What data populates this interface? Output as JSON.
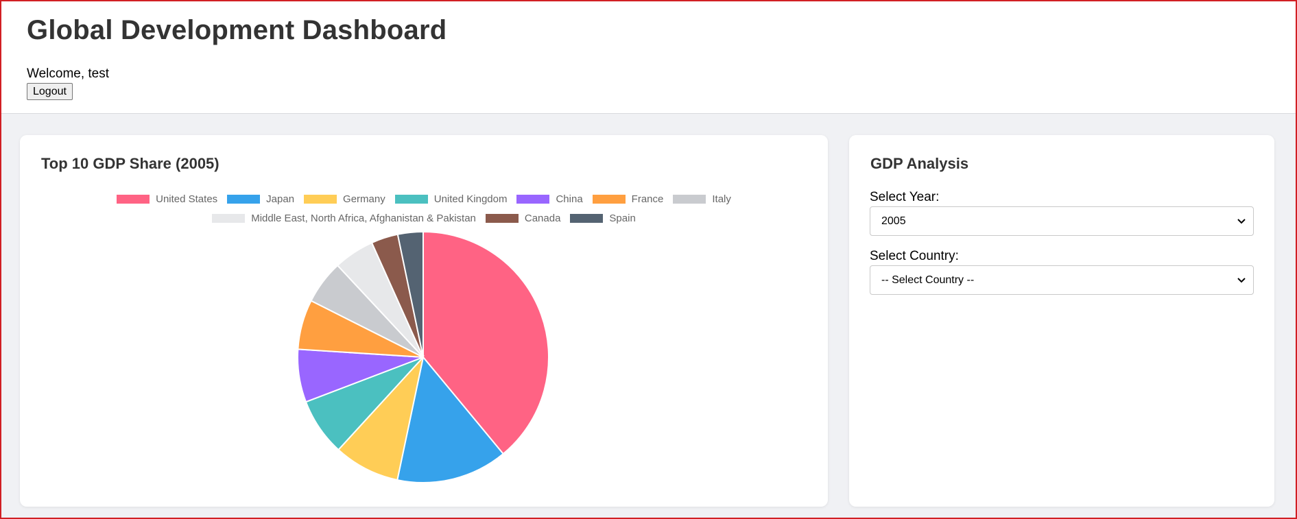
{
  "header": {
    "title": "Global Development Dashboard",
    "welcome_text": "Welcome, test",
    "logout_label": "Logout"
  },
  "chart_card": {
    "title": "Top 10 GDP Share (2005)"
  },
  "analysis": {
    "title": "GDP Analysis",
    "year_label": "Select Year:",
    "year_value": "2005",
    "country_label": "Select Country:",
    "country_value": "-- Select Country --"
  },
  "chart_data": {
    "type": "pie",
    "title": "Top 10 GDP Share (2005)",
    "categories": [
      "United States",
      "Japan",
      "Germany",
      "United Kingdom",
      "China",
      "France",
      "Italy",
      "Middle East, North Africa, Afghanistan & Pakistan",
      "Canada",
      "Spain"
    ],
    "values": [
      39.5,
      14.5,
      8.6,
      7.5,
      6.9,
      6.5,
      5.7,
      5.3,
      3.5,
      3.3
    ],
    "colors": [
      "#ff6384",
      "#36a2eb",
      "#ffcd56",
      "#4bc0c0",
      "#9966ff",
      "#ff9f40",
      "#c9cbcf",
      "#e7e8ea",
      "#8b5a4c",
      "#546372"
    ],
    "legend_position": "top"
  }
}
